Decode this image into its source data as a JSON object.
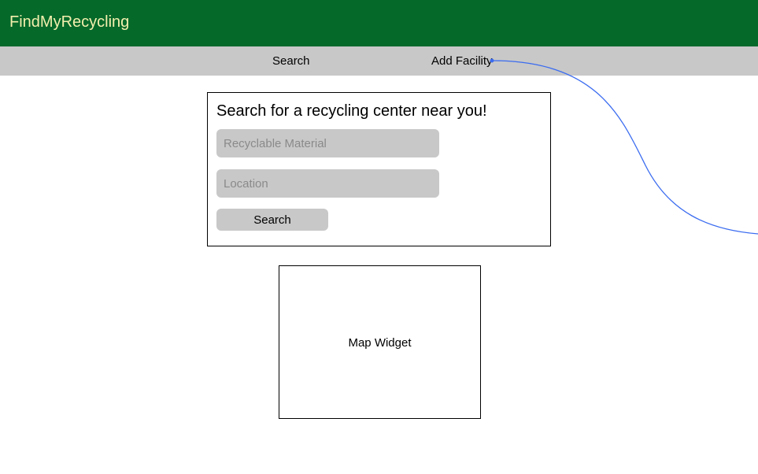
{
  "header": {
    "brand": "FindMyRecycling",
    "brand_color": "#f3efad",
    "background": "#05692a"
  },
  "nav": {
    "items": [
      {
        "label": "Search"
      },
      {
        "label": "Add Facility"
      }
    ]
  },
  "search_form": {
    "title": "Search for a recycling center near you!",
    "material_placeholder": "Recyclable Material",
    "location_placeholder": "Location",
    "button_label": "Search"
  },
  "map": {
    "label": "Map Widget"
  },
  "annotation": {
    "connector_color": "#3b6cf0"
  }
}
